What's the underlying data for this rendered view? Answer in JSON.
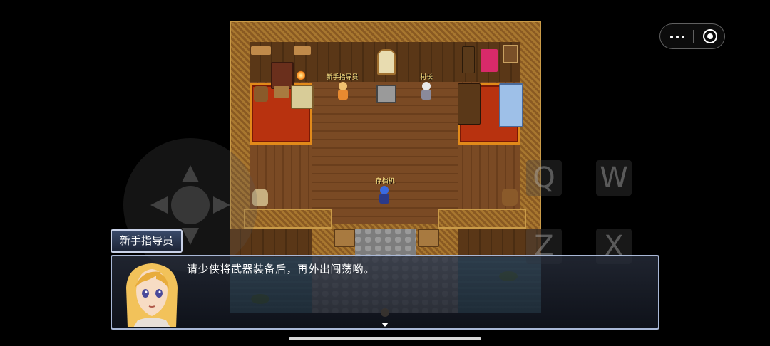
{
  "map": {
    "npc_labels": {
      "guide": "新手指导员",
      "chief": "村长",
      "save": "存档机"
    }
  },
  "capsule": {
    "more_icon": "more-dots-icon",
    "close_icon": "target-circle-icon"
  },
  "keys": {
    "q": "Q",
    "w": "W",
    "z": "Z",
    "x": "X"
  },
  "dialog": {
    "speaker": "新手指导员",
    "message": "请少侠将武器装备后，再外出闯荡哟。",
    "portrait_icon": "blonde-girl-portrait",
    "pause_icon": "down-triangle-icon"
  },
  "colors": {
    "dialog_border": "#a9b8d6",
    "label_text": "#ffe98a",
    "rug": "#b8320f"
  }
}
